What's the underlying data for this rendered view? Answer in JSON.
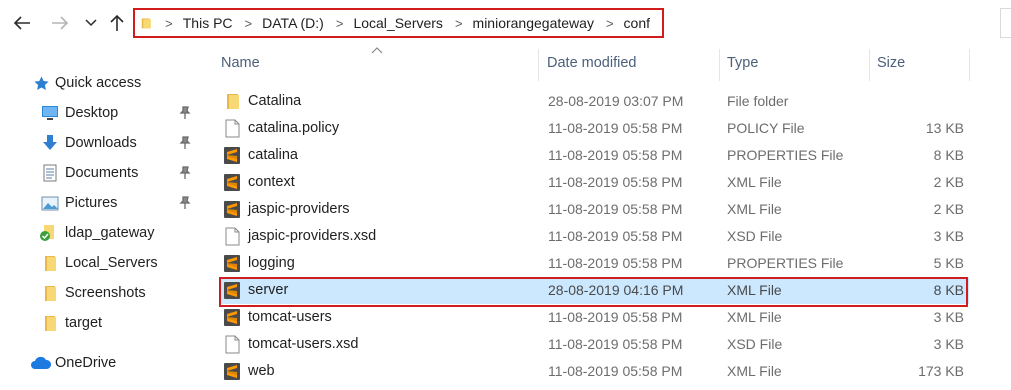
{
  "toolbar": {
    "back_icon": "arrow-left-icon",
    "forward_icon": "arrow-right-icon",
    "recent_icon": "chevron-down-icon",
    "up_icon": "arrow-up-icon"
  },
  "address": {
    "crumbs": [
      "This PC",
      "DATA (D:)",
      "Local_Servers",
      "miniorangegateway",
      "conf"
    ]
  },
  "sidebar": {
    "items": [
      {
        "label": "Quick access",
        "icon": "star-icon"
      },
      {
        "label": "Desktop",
        "icon": "desktop-icon",
        "pinned": true
      },
      {
        "label": "Downloads",
        "icon": "download-icon",
        "pinned": true
      },
      {
        "label": "Documents",
        "icon": "documents-icon",
        "pinned": true
      },
      {
        "label": "Pictures",
        "icon": "pictures-icon",
        "pinned": true
      },
      {
        "label": "ldap_gateway",
        "icon": "folder-sync-icon"
      },
      {
        "label": "Local_Servers",
        "icon": "folder-icon"
      },
      {
        "label": "Screenshots",
        "icon": "folder-icon"
      },
      {
        "label": "target",
        "icon": "folder-icon"
      },
      {
        "label": "OneDrive",
        "icon": "onedrive-icon"
      }
    ]
  },
  "columns": {
    "name": "Name",
    "date": "Date modified",
    "type": "Type",
    "size": "Size"
  },
  "files": [
    {
      "name": "Catalina",
      "date": "28-08-2019 03:07 PM",
      "type": "File folder",
      "size": "",
      "icon": "folder-icon"
    },
    {
      "name": "catalina.policy",
      "date": "11-08-2019 05:58 PM",
      "type": "POLICY File",
      "size": "13 KB",
      "icon": "file-icon"
    },
    {
      "name": "catalina",
      "date": "11-08-2019 05:58 PM",
      "type": "PROPERTIES File",
      "size": "8 KB",
      "icon": "sublime-icon"
    },
    {
      "name": "context",
      "date": "11-08-2019 05:58 PM",
      "type": "XML File",
      "size": "2 KB",
      "icon": "sublime-icon"
    },
    {
      "name": "jaspic-providers",
      "date": "11-08-2019 05:58 PM",
      "type": "XML File",
      "size": "2 KB",
      "icon": "sublime-icon"
    },
    {
      "name": "jaspic-providers.xsd",
      "date": "11-08-2019 05:58 PM",
      "type": "XSD File",
      "size": "3 KB",
      "icon": "file-icon"
    },
    {
      "name": "logging",
      "date": "11-08-2019 05:58 PM",
      "type": "PROPERTIES File",
      "size": "5 KB",
      "icon": "sublime-icon"
    },
    {
      "name": "server",
      "date": "28-08-2019 04:16 PM",
      "type": "XML File",
      "size": "8 KB",
      "icon": "sublime-icon",
      "selected": true
    },
    {
      "name": "tomcat-users",
      "date": "11-08-2019 05:58 PM",
      "type": "XML File",
      "size": "3 KB",
      "icon": "sublime-icon"
    },
    {
      "name": "tomcat-users.xsd",
      "date": "11-08-2019 05:58 PM",
      "type": "XSD File",
      "size": "3 KB",
      "icon": "file-icon"
    },
    {
      "name": "web",
      "date": "11-08-2019 05:58 PM",
      "type": "XML File",
      "size": "173 KB",
      "icon": "sublime-icon"
    }
  ],
  "colors": {
    "highlight_border": "#d01c1c",
    "selection": "#cce8ff",
    "header_text": "#4c607a",
    "folder": "#f8d775",
    "sublime": "#4a4a4a",
    "sublime_accent": "#ff9800"
  }
}
